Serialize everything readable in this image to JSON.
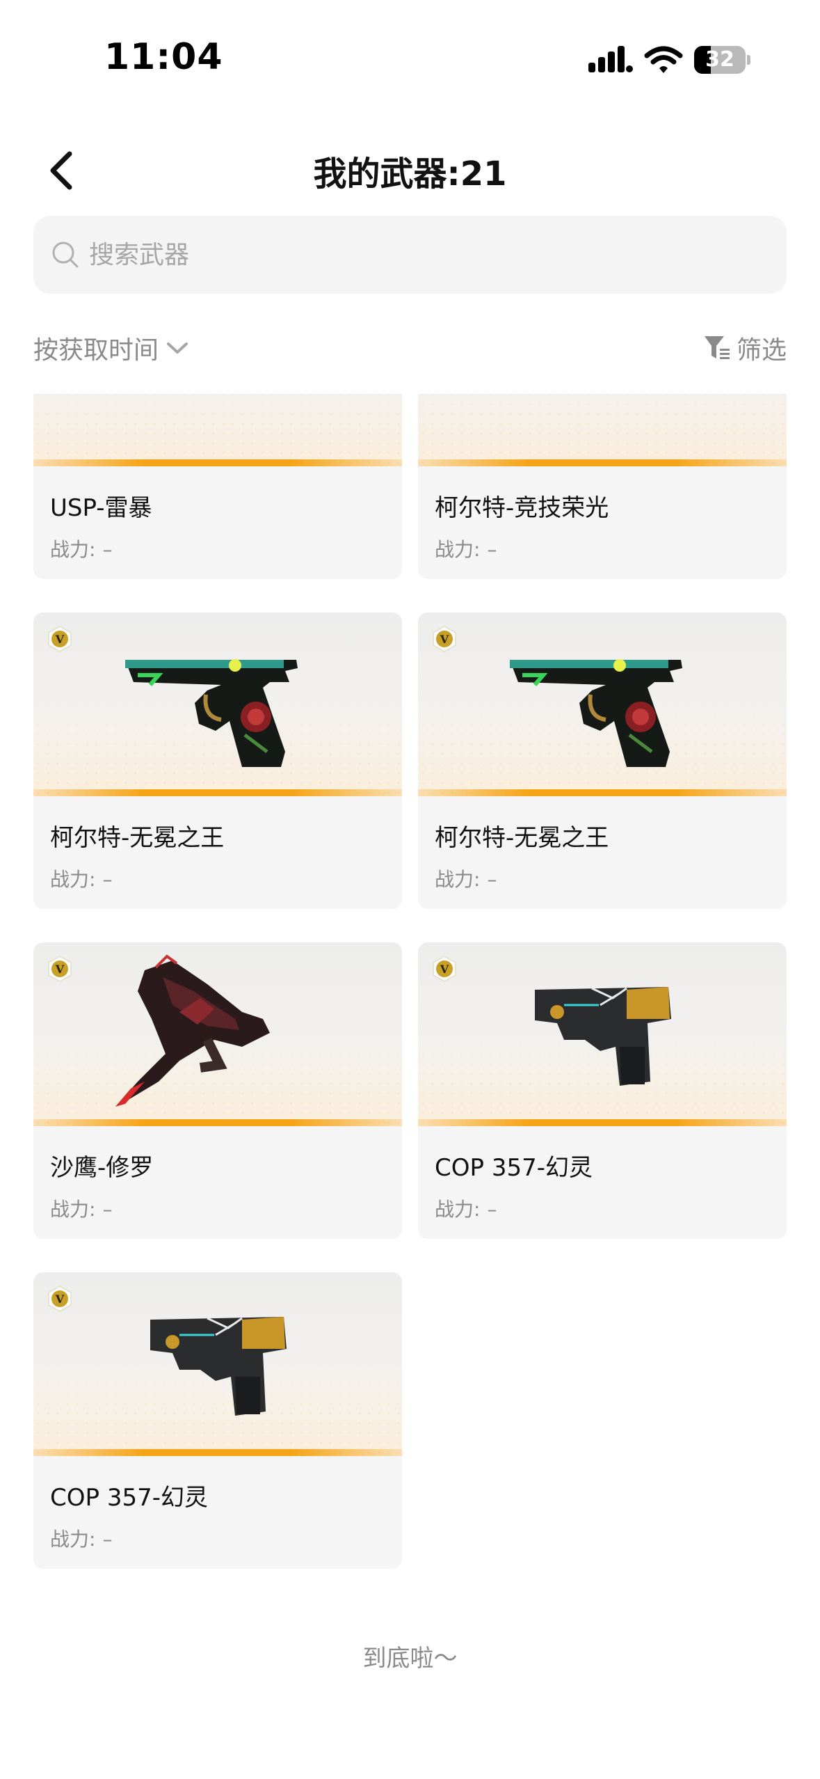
{
  "status_bar": {
    "time": "11:04",
    "battery": "32",
    "battery_level_percent": 32
  },
  "header": {
    "title": "我的武器:21",
    "back_icon": "chevron-left-icon"
  },
  "search": {
    "placeholder": "搜索武器",
    "value": "",
    "icon": "search-icon"
  },
  "toolbar": {
    "sort_label": "按获取时间",
    "sort_icon": "chevron-down-icon",
    "filter_label": "筛选",
    "filter_icon": "filter-icon"
  },
  "weapons": [
    {
      "name": "USP-雷暴",
      "power_label": "战力:",
      "power_value": "–",
      "badge": "",
      "art": "usp-pistol"
    },
    {
      "name": "柯尔特-竞技荣光",
      "power_label": "战力:",
      "power_value": "–",
      "badge": "",
      "art": "colt-pistol-purple"
    },
    {
      "name": "柯尔特-无冕之王",
      "power_label": "战力:",
      "power_value": "–",
      "badge": "V",
      "art": "colt-pistol-rose"
    },
    {
      "name": "柯尔特-无冕之王",
      "power_label": "战力:",
      "power_value": "–",
      "badge": "V",
      "art": "colt-pistol-rose"
    },
    {
      "name": "沙鹰-修罗",
      "power_label": "战力:",
      "power_value": "–",
      "badge": "V",
      "art": "desert-eagle-blade"
    },
    {
      "name": "COP 357-幻灵",
      "power_label": "战力:",
      "power_value": "–",
      "badge": "V",
      "art": "cop357-pistol"
    },
    {
      "name": "COP 357-幻灵",
      "power_label": "战力:",
      "power_value": "–",
      "badge": "V",
      "art": "cop357-pistol"
    }
  ],
  "footer": {
    "end_text": "到底啦～"
  },
  "colors": {
    "accent_orange": "#f5a417",
    "badge_gold": "#c8a028",
    "muted_text": "#8a8a8a",
    "card_bg": "#f5f5f5"
  }
}
